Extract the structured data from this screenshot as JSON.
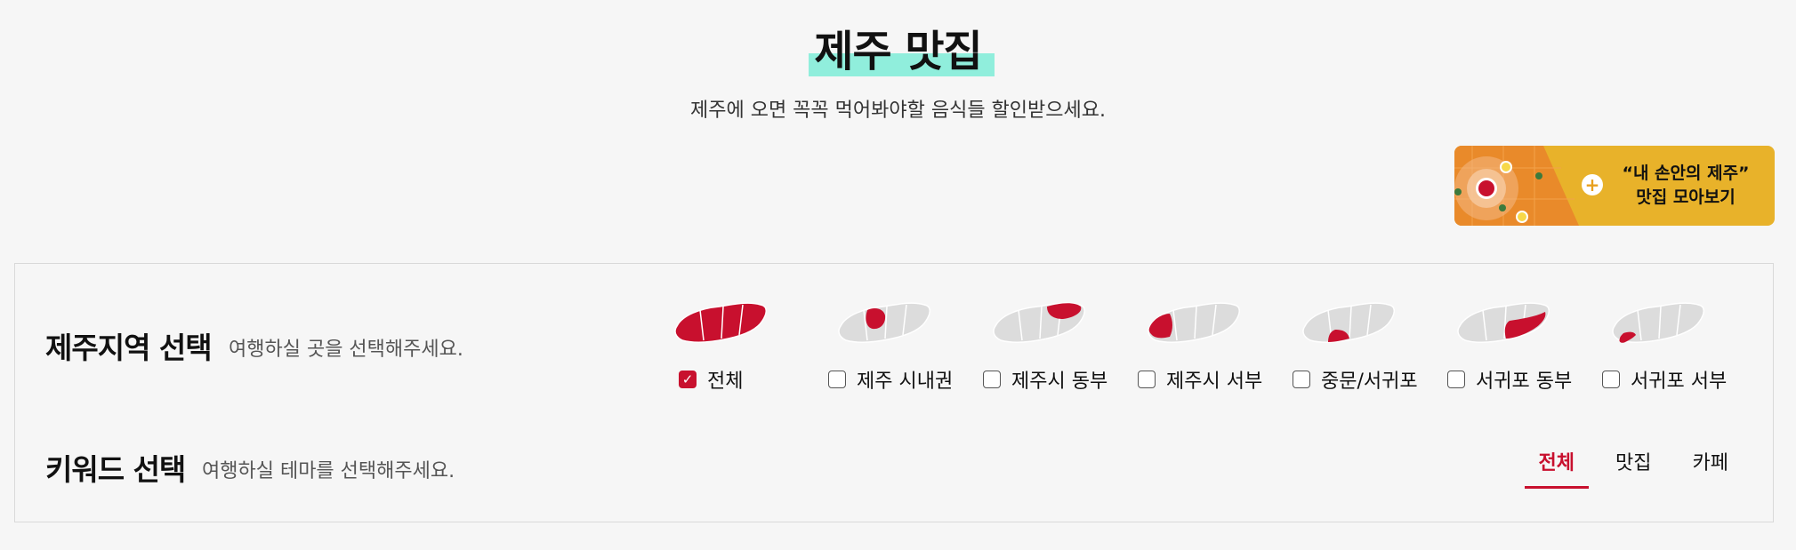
{
  "header": {
    "title": "제주 맛집",
    "subtitle": "제주에 오면 꼭꼭 먹어봐야할 음식들 할인받으세요."
  },
  "promo": {
    "line1": "“내 손안의 제주”",
    "line2": "맛집  모아보기",
    "plus": "+"
  },
  "region_section": {
    "title": "제주지역 선택",
    "desc": "여행하실 곳을 선택해주세요.",
    "options": [
      {
        "label": "전체",
        "checked": true,
        "highlight": "all"
      },
      {
        "label": "제주 시내권",
        "checked": false,
        "highlight": "city"
      },
      {
        "label": "제주시 동부",
        "checked": false,
        "highlight": "ne"
      },
      {
        "label": "제주시 서부",
        "checked": false,
        "highlight": "nw"
      },
      {
        "label": "중문/서귀포",
        "checked": false,
        "highlight": "s"
      },
      {
        "label": "서귀포 동부",
        "checked": false,
        "highlight": "se"
      },
      {
        "label": "서귀포 서부",
        "checked": false,
        "highlight": "sw"
      }
    ]
  },
  "keyword_section": {
    "title": "키워드 선택",
    "desc": "여행하실 테마를 선택해주세요.",
    "tabs": [
      {
        "label": "전체",
        "active": true
      },
      {
        "label": "맛집",
        "active": false
      },
      {
        "label": "카페",
        "active": false
      }
    ]
  },
  "colors": {
    "accent": "#c8102e",
    "highlight": "#90eedc",
    "promo": "#e8b22a"
  },
  "icons": {
    "checkbox_checked": "check-icon",
    "promo_plus": "plus-icon"
  }
}
